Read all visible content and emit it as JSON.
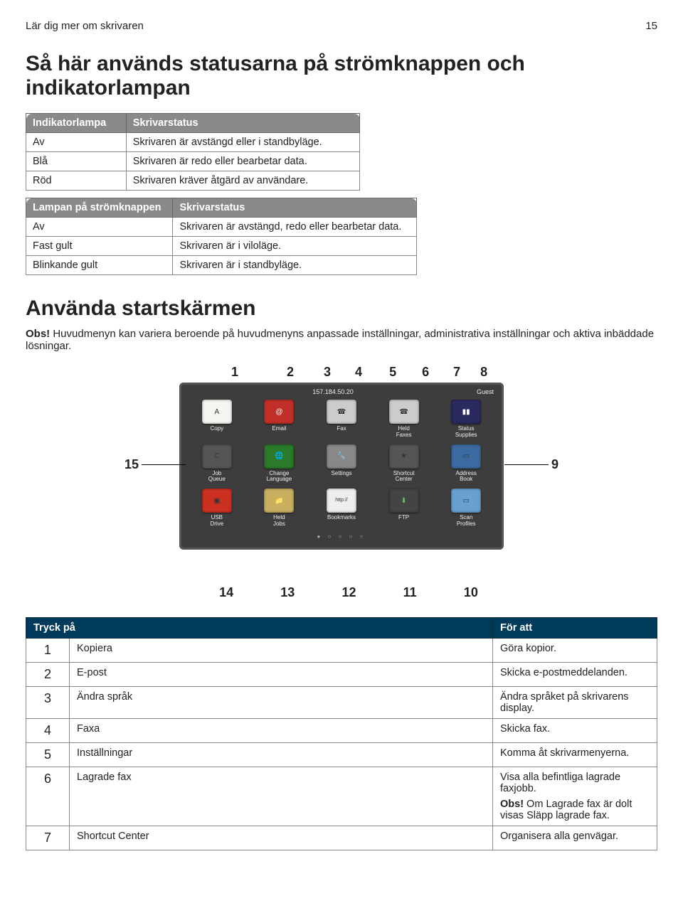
{
  "header": {
    "left": "Lär dig mer om skrivaren",
    "right": "15"
  },
  "h1": "Så här används statusarna på strömknappen och indikatorlampan",
  "table1": {
    "head": [
      "Indikatorlampa",
      "Skrivarstatus"
    ],
    "rows": [
      [
        "Av",
        "Skrivaren är avstängd eller i standbyläge."
      ],
      [
        "Blå",
        "Skrivaren är redo eller bearbetar data."
      ],
      [
        "Röd",
        "Skrivaren kräver åtgärd av användare."
      ]
    ]
  },
  "table2": {
    "head": [
      "Lampan på strömknappen",
      "Skrivarstatus"
    ],
    "rows": [
      [
        "Av",
        "Skrivaren är avstängd, redo eller bearbetar data."
      ],
      [
        "Fast gult",
        "Skrivaren är i viloläge."
      ],
      [
        "Blinkande gult",
        "Skrivaren är i standbyläge."
      ]
    ]
  },
  "h2": "Använda startskärmen",
  "note": {
    "bold": "Obs!",
    "text": " Huvudmenyn kan variera beroende på huvudmenyns anpassade inställningar, administrativa inställningar och aktiva inbäddade lösningar."
  },
  "callouts": {
    "top": [
      "1",
      "2",
      "3",
      "4",
      "5",
      "6",
      "7",
      "8"
    ],
    "left": "15",
    "right": "9",
    "bottom": [
      "14",
      "13",
      "12",
      "11",
      "10"
    ]
  },
  "screen": {
    "ip": "157.184.50.20",
    "guest": "Guest",
    "tiles": [
      {
        "label": "Copy",
        "cls": "copy",
        "glyph": "A"
      },
      {
        "label": "Email",
        "cls": "email",
        "glyph": "@"
      },
      {
        "label": "Fax",
        "cls": "fax",
        "glyph": "☎"
      },
      {
        "label": "Held Faxes",
        "cls": "held",
        "glyph": "☎"
      },
      {
        "label": "Status Supplies",
        "cls": "status",
        "glyph": "▮▮"
      },
      {
        "label": "Job Queue",
        "cls": "jobq",
        "glyph": "C"
      },
      {
        "label": "Change Language",
        "cls": "lang",
        "glyph": "🌐"
      },
      {
        "label": "Settings",
        "cls": "set",
        "glyph": "🔧"
      },
      {
        "label": "Shortcut Center",
        "cls": "shortcut",
        "glyph": "★"
      },
      {
        "label": "Address Book",
        "cls": "addr",
        "glyph": "▭"
      },
      {
        "label": "USB Drive",
        "cls": "usb",
        "glyph": "▣"
      },
      {
        "label": "Held Jobs",
        "cls": "hjobs",
        "glyph": "📁"
      },
      {
        "label": "Bookmarks",
        "cls": "book",
        "glyph": "http://"
      },
      {
        "label": "FTP",
        "cls": "ftp",
        "glyph": "⬇"
      },
      {
        "label": "Scan Profiles",
        "cls": "scan",
        "glyph": "▭"
      }
    ]
  },
  "actions": {
    "head": [
      "",
      "Tryck på",
      "För att"
    ],
    "rows": [
      {
        "n": "1",
        "name": "Kopiera",
        "desc": "Göra kopior."
      },
      {
        "n": "2",
        "name": "E-post",
        "desc": "Skicka e-postmeddelanden."
      },
      {
        "n": "3",
        "name": "Ändra språk",
        "desc": "Ändra språket på skrivarens display."
      },
      {
        "n": "4",
        "name": "Faxa",
        "desc": "Skicka fax."
      },
      {
        "n": "5",
        "name": "Inställningar",
        "desc": "Komma åt skrivarmenyerna."
      },
      {
        "n": "6",
        "name": "Lagrade fax",
        "desc": "Visa alla befintliga lagrade faxjobb.",
        "sub_bold": "Obs!",
        "sub": " Om Lagrade fax är dolt visas Släpp lagrade fax."
      },
      {
        "n": "7",
        "name": "Shortcut Center",
        "desc": "Organisera alla genvägar."
      }
    ]
  }
}
